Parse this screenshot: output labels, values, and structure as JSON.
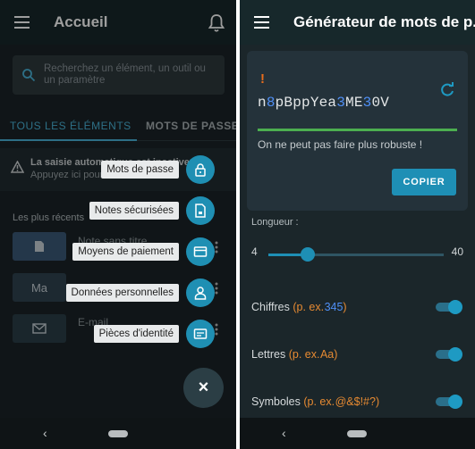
{
  "left": {
    "appbar": {
      "title": "Accueil"
    },
    "search": {
      "placeholder": "Recherchez un élément, un outil ou un paramètre"
    },
    "tabs": [
      {
        "label": "TOUS LES ÉLÉMENTS"
      },
      {
        "label": "MOTS DE PASSE"
      }
    ],
    "warning": {
      "title": "La saisie automatique est inactive",
      "subtitle": "Appuyez ici pour l'activer"
    },
    "recent": {
      "title": "Les plus récents",
      "items": [
        {
          "label": "Note sans titre",
          "thumb": "file-icon"
        },
        {
          "label": "Ma",
          "thumb": "text"
        },
        {
          "label": "E-mail",
          "thumb": "mail-icon"
        }
      ]
    },
    "fab_menu": [
      {
        "label": "Mots de passe",
        "icon": "lock-icon"
      },
      {
        "label": "Notes sécurisées",
        "icon": "note-icon"
      },
      {
        "label": "Moyens de paiement",
        "icon": "card-icon"
      },
      {
        "label": "Données personnelles",
        "icon": "person-icon"
      },
      {
        "label": "Pièces d'identité",
        "icon": "id-card-icon"
      }
    ],
    "fab_close": "×",
    "nav_back": "‹"
  },
  "right": {
    "appbar": {
      "title": "Générateur de mots de p..."
    },
    "generator": {
      "alert": "!",
      "password_parts": [
        "n",
        "8",
        "pBppYea",
        "3",
        "ME",
        "3",
        "0V"
      ],
      "strength": "On ne peut pas faire plus robuste !",
      "copy_label": "COPIER"
    },
    "length": {
      "label": "Longueur :",
      "min": "4",
      "max": "40",
      "value": 12
    },
    "options": [
      {
        "label": "Chiffres",
        "example_prefix": "(p. ex.",
        "example": "345",
        "example_suffix": ")",
        "enabled": true
      },
      {
        "label": "Lettres",
        "example_prefix": "(p. ex.",
        "example": "Aa",
        "example_suffix": ")",
        "enabled": true
      },
      {
        "label": "Symboles",
        "example_prefix": "(p. ex.",
        "example": "@&$!#?",
        "example_suffix": ")",
        "enabled": true
      }
    ],
    "nav_back": "‹"
  },
  "colors": {
    "accent": "#1e8fb5",
    "orange": "#e68a32",
    "blue_digit": "#4f8ff5",
    "strength": "#4caf50"
  }
}
